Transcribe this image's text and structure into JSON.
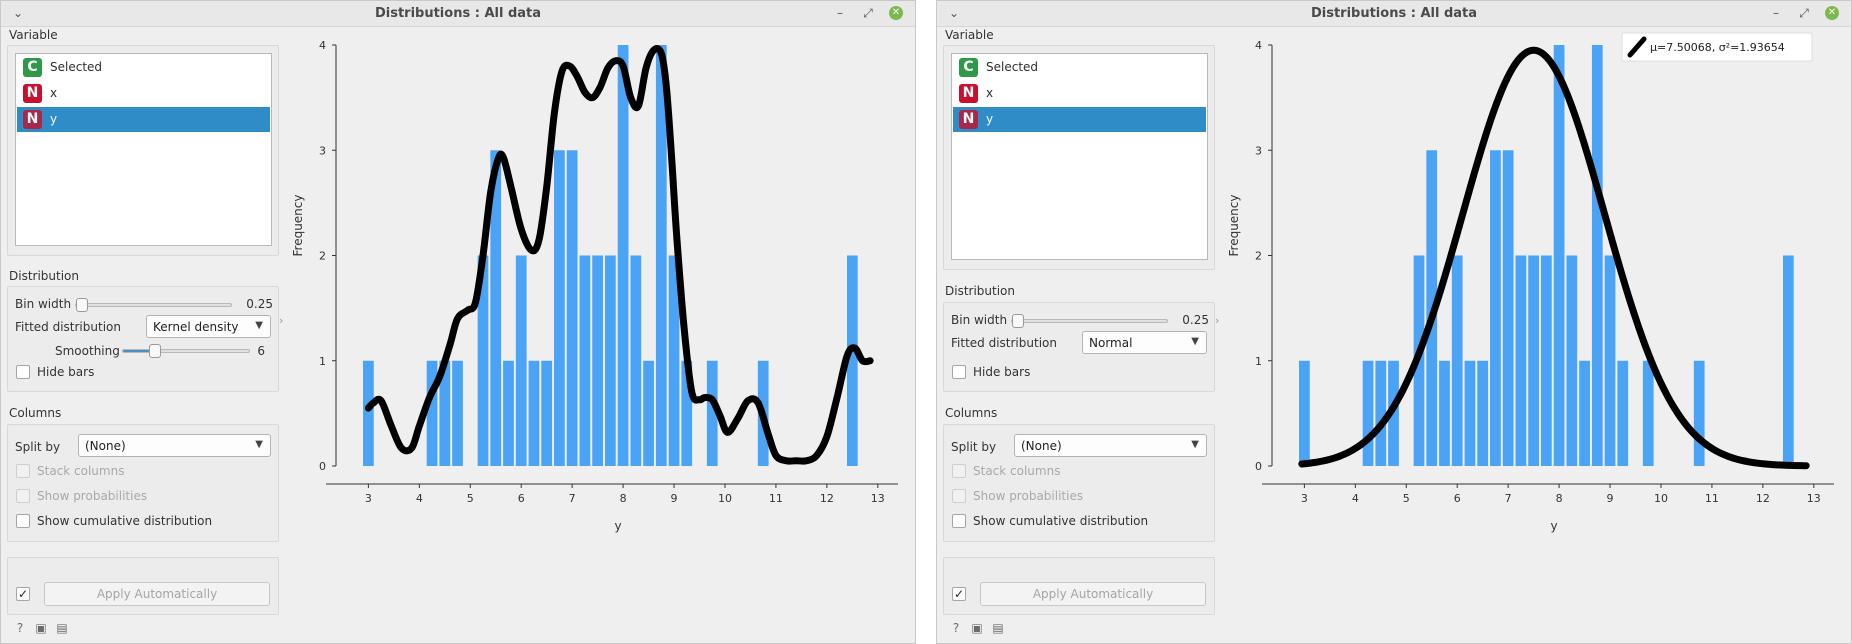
{
  "windows": [
    {
      "title": "Distributions : All data",
      "variable_label": "Variable",
      "variables": [
        {
          "badge": "C",
          "kind": "c",
          "label": "Selected",
          "selected": false
        },
        {
          "badge": "N",
          "kind": "n",
          "label": "x",
          "selected": false
        },
        {
          "badge": "N",
          "kind": "n",
          "label": "y",
          "selected": true
        }
      ],
      "distribution_label": "Distribution",
      "bin_width_label": "Bin width",
      "bin_width_value": "0.25",
      "bin_width_fraction": 0.02,
      "fitted_label": "Fitted distribution",
      "fitted_value": "Kernel density",
      "smoothing_label": "Smoothing",
      "smoothing_value": "6",
      "smoothing_fraction": 0.25,
      "hide_bars_label": "Hide bars",
      "hide_bars_checked": false,
      "columns_label": "Columns",
      "split_by_label": "Split by",
      "split_by_value": "(None)",
      "stack_columns_label": "Stack columns",
      "show_probabilities_label": "Show probabilities",
      "show_cumulative_label": "Show cumulative distribution",
      "apply_auto_label": "Apply Automatically",
      "apply_auto_checked": true,
      "footer_icons": [
        "help-icon",
        "save-icon",
        "report-icon"
      ]
    },
    {
      "title": "Distributions : All data",
      "variable_label": "Variable",
      "variables": [
        {
          "badge": "C",
          "kind": "c",
          "label": "Selected",
          "selected": false
        },
        {
          "badge": "N",
          "kind": "n",
          "label": "x",
          "selected": false
        },
        {
          "badge": "N",
          "kind": "n",
          "label": "y",
          "selected": true
        }
      ],
      "distribution_label": "Distribution",
      "bin_width_label": "Bin width",
      "bin_width_value": "0.25",
      "bin_width_fraction": 0.02,
      "fitted_label": "Fitted distribution",
      "fitted_value": "Normal",
      "hide_bars_label": "Hide bars",
      "hide_bars_checked": false,
      "columns_label": "Columns",
      "split_by_label": "Split by",
      "split_by_value": "(None)",
      "stack_columns_label": "Stack columns",
      "show_probabilities_label": "Show probabilities",
      "show_cumulative_label": "Show cumulative distribution",
      "apply_auto_label": "Apply Automatically",
      "apply_auto_checked": true,
      "footer_icons": [
        "help-icon",
        "save-icon",
        "report-icon"
      ]
    }
  ],
  "colors": {
    "bar": "#4aa3f5",
    "curve": "#000000",
    "selection": "#308cc6"
  },
  "chart_data": [
    {
      "type": "bar",
      "xlabel": "y",
      "ylabel": "Frequency",
      "xlim": [
        2.6,
        13.2
      ],
      "ylim": [
        0,
        4
      ],
      "xticks": [
        3,
        4,
        5,
        6,
        7,
        8,
        9,
        10,
        11,
        12,
        13
      ],
      "yticks": [
        0,
        1,
        2,
        3,
        4
      ],
      "bin_width": 0.25,
      "bins": [
        {
          "x": 3.0,
          "count": 1
        },
        {
          "x": 4.25,
          "count": 1
        },
        {
          "x": 4.5,
          "count": 1
        },
        {
          "x": 4.75,
          "count": 1
        },
        {
          "x": 5.25,
          "count": 2
        },
        {
          "x": 5.5,
          "count": 3
        },
        {
          "x": 5.75,
          "count": 1
        },
        {
          "x": 6.0,
          "count": 2
        },
        {
          "x": 6.25,
          "count": 1
        },
        {
          "x": 6.5,
          "count": 1
        },
        {
          "x": 6.75,
          "count": 3
        },
        {
          "x": 7.0,
          "count": 3
        },
        {
          "x": 7.25,
          "count": 2
        },
        {
          "x": 7.5,
          "count": 2
        },
        {
          "x": 7.75,
          "count": 2
        },
        {
          "x": 8.0,
          "count": 4
        },
        {
          "x": 8.25,
          "count": 2
        },
        {
          "x": 8.5,
          "count": 1
        },
        {
          "x": 8.75,
          "count": 4
        },
        {
          "x": 9.0,
          "count": 2
        },
        {
          "x": 9.25,
          "count": 1
        },
        {
          "x": 9.75,
          "count": 1
        },
        {
          "x": 10.75,
          "count": 1
        },
        {
          "x": 12.5,
          "count": 2
        }
      ],
      "curve": {
        "name": "Kernel density",
        "x": [
          3.0,
          3.1,
          3.25,
          3.45,
          3.65,
          3.85,
          4.0,
          4.2,
          4.4,
          4.6,
          4.75,
          4.95,
          5.1,
          5.25,
          5.4,
          5.55,
          5.65,
          5.8,
          6.0,
          6.2,
          6.35,
          6.5,
          6.65,
          6.8,
          6.95,
          7.1,
          7.25,
          7.4,
          7.55,
          7.7,
          7.85,
          8.0,
          8.15,
          8.3,
          8.45,
          8.6,
          8.75,
          8.85,
          8.95,
          9.05,
          9.2,
          9.35,
          9.5,
          9.6,
          9.75,
          9.9,
          10.05,
          10.25,
          10.45,
          10.65,
          10.85,
          11.0,
          11.2,
          11.4,
          11.6,
          11.8,
          12.0,
          12.2,
          12.4,
          12.55,
          12.7,
          12.85
        ],
        "y": [
          0.55,
          0.6,
          0.62,
          0.38,
          0.17,
          0.17,
          0.38,
          0.65,
          0.85,
          1.15,
          1.4,
          1.48,
          1.55,
          2.0,
          2.6,
          2.92,
          2.93,
          2.65,
          2.25,
          2.05,
          2.15,
          2.65,
          3.35,
          3.75,
          3.8,
          3.7,
          3.55,
          3.5,
          3.6,
          3.78,
          3.85,
          3.8,
          3.5,
          3.42,
          3.78,
          3.95,
          3.92,
          3.6,
          2.95,
          2.2,
          1.3,
          0.7,
          0.63,
          0.65,
          0.63,
          0.48,
          0.32,
          0.45,
          0.62,
          0.6,
          0.3,
          0.1,
          0.05,
          0.05,
          0.05,
          0.1,
          0.28,
          0.65,
          1.05,
          1.12,
          1.0,
          1.0
        ]
      }
    },
    {
      "type": "bar",
      "xlabel": "y",
      "ylabel": "Frequency",
      "xlim": [
        2.6,
        13.2
      ],
      "ylim": [
        0,
        4
      ],
      "xticks": [
        3,
        4,
        5,
        6,
        7,
        8,
        9,
        10,
        11,
        12,
        13
      ],
      "yticks": [
        0,
        1,
        2,
        3,
        4
      ],
      "bin_width": 0.25,
      "bins": [
        {
          "x": 3.0,
          "count": 1
        },
        {
          "x": 4.25,
          "count": 1
        },
        {
          "x": 4.5,
          "count": 1
        },
        {
          "x": 4.75,
          "count": 1
        },
        {
          "x": 5.25,
          "count": 2
        },
        {
          "x": 5.5,
          "count": 3
        },
        {
          "x": 5.75,
          "count": 1
        },
        {
          "x": 6.0,
          "count": 2
        },
        {
          "x": 6.25,
          "count": 1
        },
        {
          "x": 6.5,
          "count": 1
        },
        {
          "x": 6.75,
          "count": 3
        },
        {
          "x": 7.0,
          "count": 3
        },
        {
          "x": 7.25,
          "count": 2
        },
        {
          "x": 7.5,
          "count": 2
        },
        {
          "x": 7.75,
          "count": 2
        },
        {
          "x": 8.0,
          "count": 4
        },
        {
          "x": 8.25,
          "count": 2
        },
        {
          "x": 8.5,
          "count": 1
        },
        {
          "x": 8.75,
          "count": 4
        },
        {
          "x": 9.0,
          "count": 2
        },
        {
          "x": 9.25,
          "count": 1
        },
        {
          "x": 9.75,
          "count": 1
        },
        {
          "x": 10.75,
          "count": 1
        },
        {
          "x": 12.5,
          "count": 2
        }
      ],
      "curve": {
        "name": "Normal",
        "normal": {
          "mu": 7.50068,
          "sigma2": 1.93654
        },
        "x_range": [
          2.95,
          12.85
        ],
        "peak": 3.95
      },
      "legend": {
        "label": "μ=7.50068, σ²=1.93654",
        "position": "top-right"
      }
    }
  ]
}
